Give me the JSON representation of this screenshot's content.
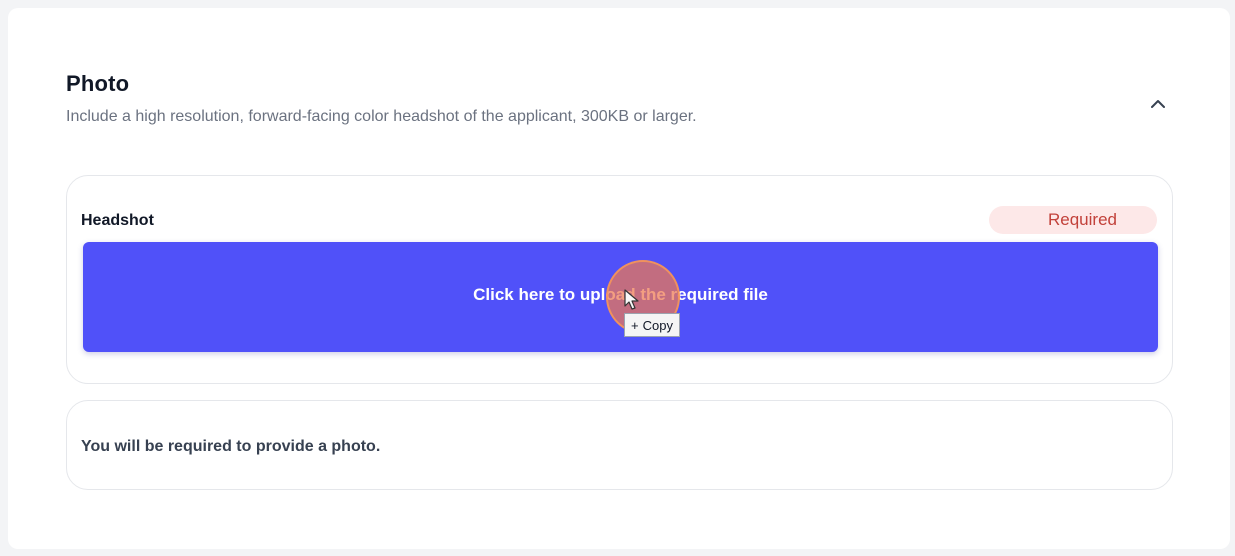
{
  "section": {
    "title": "Photo",
    "description": "Include a high resolution, forward-facing color headshot of the applicant, 300KB or larger."
  },
  "upload_field": {
    "label": "Headshot",
    "badge": "Required",
    "button_label": "Click here to upload the required file",
    "drag_tooltip": "Copy",
    "drag_tooltip_prefix": "+"
  },
  "note": {
    "text": "You will be required to provide a photo."
  },
  "colors": {
    "accent": "#5051f9",
    "badge_bg": "#fde8e8",
    "badge_text": "#c2413a",
    "click_indicator": "#ee7850"
  },
  "icons": {
    "collapse": "chevron-up-icon",
    "cursor": "cursor-arrow-icon"
  }
}
